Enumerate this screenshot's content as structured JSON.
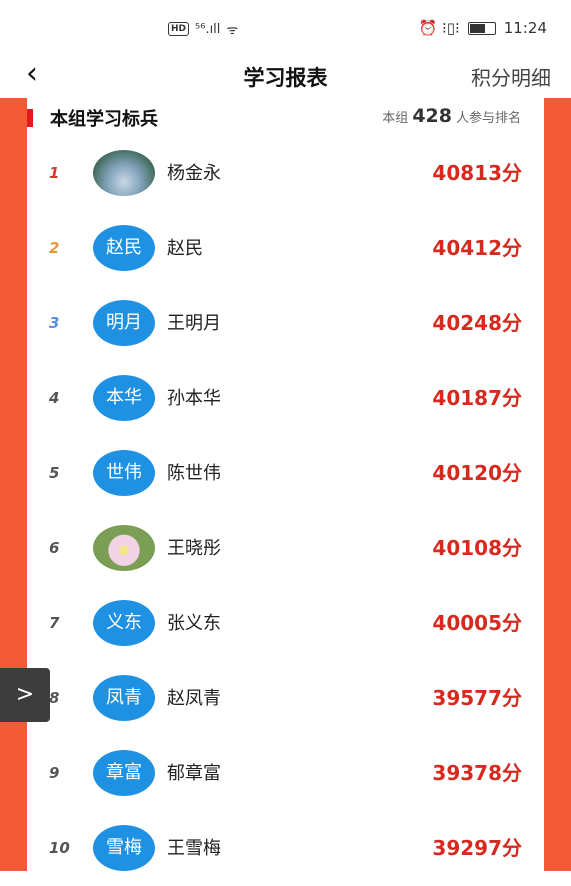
{
  "status_bar": {
    "hd": "HD",
    "signal": "⁵⁶.ıll",
    "wifi": "ᯤ",
    "alarm": "⏰ ⁝▯⁝",
    "time": "11:24"
  },
  "header": {
    "back_icon": "‹",
    "title": "学习报表",
    "detail_link": "积分明细"
  },
  "section": {
    "title": "本组学习标兵",
    "info_prefix": "本组",
    "count": "428",
    "info_suffix": "人参与排名"
  },
  "rows": [
    {
      "rank": "1",
      "avatar": "",
      "name": "杨金永",
      "score": "40813分"
    },
    {
      "rank": "2",
      "avatar": "赵民",
      "name": "赵民",
      "score": "40412分"
    },
    {
      "rank": "3",
      "avatar": "明月",
      "name": "王明月",
      "score": "40248分"
    },
    {
      "rank": "4",
      "avatar": "本华",
      "name": "孙本华",
      "score": "40187分"
    },
    {
      "rank": "5",
      "avatar": "世伟",
      "name": "陈世伟",
      "score": "40120分"
    },
    {
      "rank": "6",
      "avatar": "",
      "name": "王晓彤",
      "score": "40108分"
    },
    {
      "rank": "7",
      "avatar": "义东",
      "name": "张义东",
      "score": "40005分"
    },
    {
      "rank": "8",
      "avatar": "凤青",
      "name": "赵凤青",
      "score": "39577分"
    },
    {
      "rank": "9",
      "avatar": "章富",
      "name": "郁章富",
      "score": "39378分"
    },
    {
      "rank": "10",
      "avatar": "雪梅",
      "name": "王雪梅",
      "score": "39297分"
    }
  ],
  "side_handle": ">",
  "colors": {
    "accent": "#f25a38",
    "score": "#d62a1f",
    "avatar_bg": "#1f91e3"
  }
}
